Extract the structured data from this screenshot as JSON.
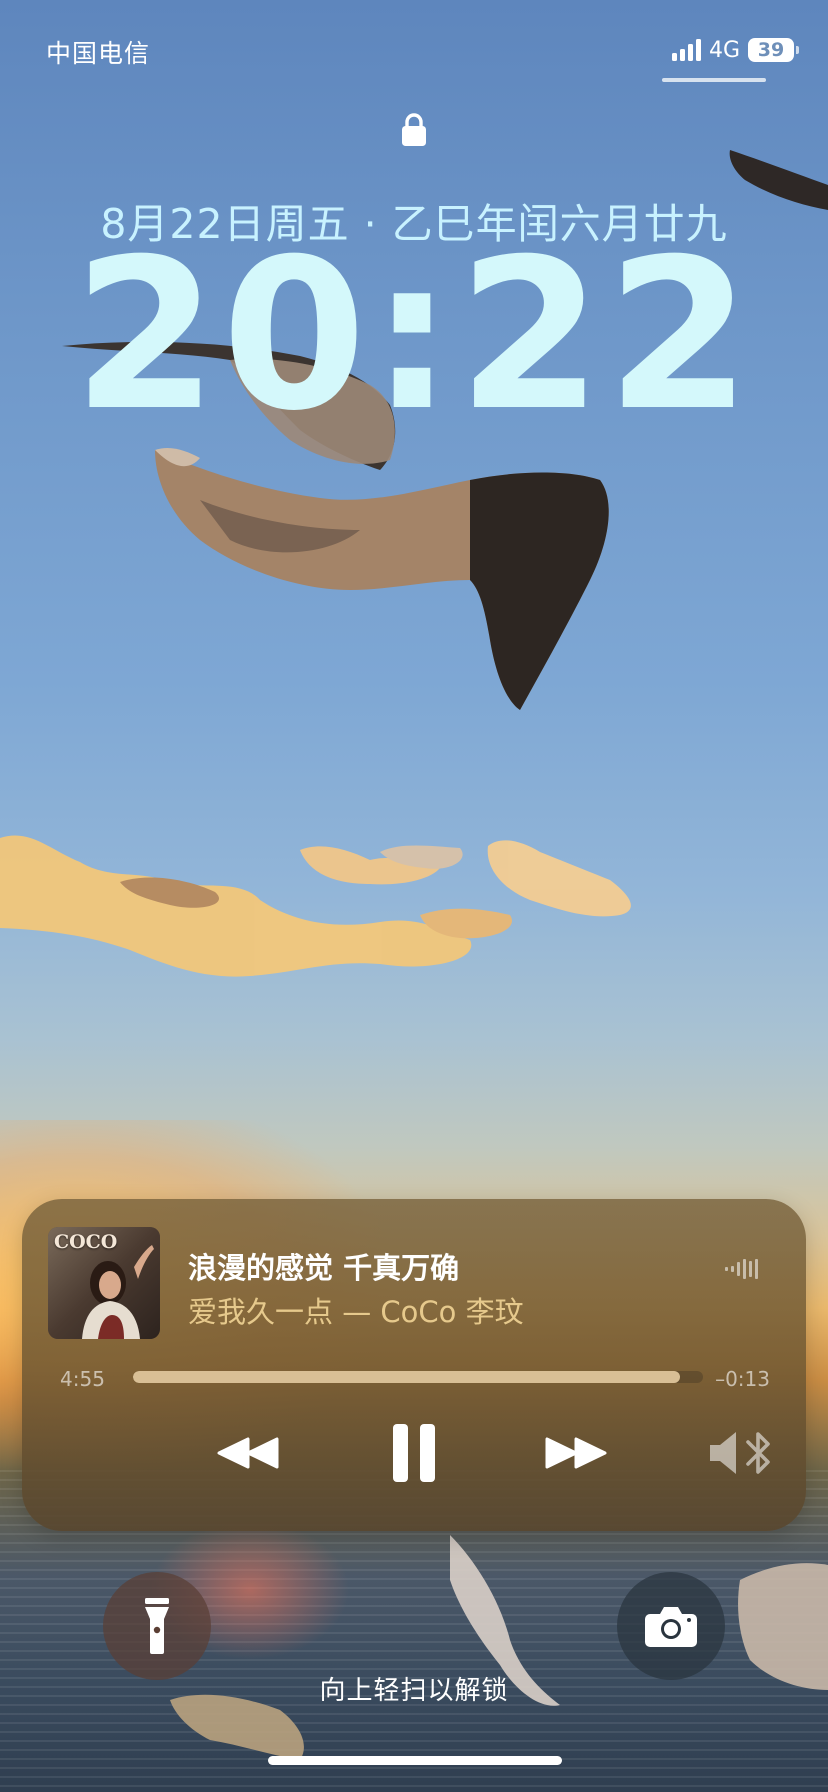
{
  "status_bar": {
    "carrier": "中国电信",
    "network": "4G",
    "battery": "39"
  },
  "lock_screen": {
    "date": "8月22日周五 · 乙巳年闰六月廿九",
    "time": "20:22"
  },
  "now_playing": {
    "album_brand": "COCO",
    "title": "浪漫的感觉 千真万确",
    "subtitle": "爱我久一点 — CoCo 李玟",
    "elapsed": "4:55",
    "remaining": "–0:13",
    "progress": 0.96
  },
  "bottom": {
    "unlock_hint": "向上轻扫以解锁"
  },
  "icons": {
    "lock": "lock-icon",
    "signal": "cellular-signal-icon",
    "battery": "battery-icon",
    "audio_wave": "audio-waveform-icon",
    "rewind": "rewind-icon",
    "pause": "pause-icon",
    "forward": "fast-forward-icon",
    "output": "bluetooth-speaker-icon",
    "flashlight": "flashlight-icon",
    "camera": "camera-icon"
  },
  "colors": {
    "clock": "#d4f8fb",
    "date": "#c8f2ff",
    "subtitle": "#e6c98c",
    "progress_fill": "#d9bf95"
  }
}
